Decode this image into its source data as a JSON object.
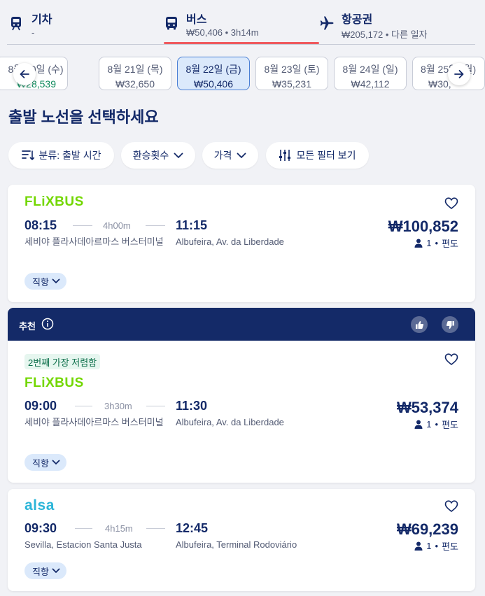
{
  "modes": {
    "train": {
      "title": "기차",
      "sub": "-"
    },
    "bus": {
      "title": "버스",
      "sub": "₩50,406 • 3h14m"
    },
    "flight": {
      "title": "항공권",
      "sub": "₩205,172 • 다른 일자"
    }
  },
  "dates": [
    {
      "date": "8월 20일 (수)",
      "price": "₩28,539"
    },
    {
      "date": "8월 21일 (목)",
      "price": "₩32,650"
    },
    {
      "date": "8월 22일 (금)",
      "price": "₩50,406"
    },
    {
      "date": "8월 23일 (토)",
      "price": "₩35,231"
    },
    {
      "date": "8월 24일 (일)",
      "price": "₩42,112"
    },
    {
      "date": "8월 25일 (월)",
      "price": "₩30,"
    }
  ],
  "page_title": "출발 노선을 선택하세요",
  "filters": {
    "sort": "분류: 출발 시간",
    "transfers": "환승횟수",
    "price": "가격",
    "all": "모든 필터 보기"
  },
  "recommend": {
    "label": "추천"
  },
  "results": [
    {
      "operator": "FLiXBUS",
      "depart": "08:15",
      "duration": "4h00m",
      "arrive": "11:15",
      "from": "세비야 플라사데아르마스 버스터미널",
      "to": "Albufeira, Av. da Liberdade",
      "price": "₩100,852",
      "pax": "1",
      "trip": "편도",
      "direct": "직항"
    },
    {
      "badge": "2번째 가장 저렴함",
      "operator": "FLiXBUS",
      "depart": "09:00",
      "duration": "3h30m",
      "arrive": "11:30",
      "from": "세비야 플라사데아르마스 버스터미널",
      "to": "Albufeira, Av. da Liberdade",
      "price": "₩53,374",
      "pax": "1",
      "trip": "편도",
      "direct": "직항"
    },
    {
      "operator": "alsa",
      "depart": "09:30",
      "duration": "4h15m",
      "arrive": "12:45",
      "from": "Sevilla, Estacion Santa Justa",
      "to": "Albufeira, Terminal Rodoviário",
      "price": "₩69,239",
      "pax": "1",
      "trip": "편도",
      "direct": "직항"
    }
  ],
  "colors": {
    "navy": "#132968",
    "accent_red": "#ef5a5f",
    "flixbus_green": "#73d700",
    "alsa_blue": "#2bb5d8",
    "selected_date_bg": "#dbe9fb",
    "recommend_band": "#142a68",
    "cheap_green": "#0d8a5c"
  },
  "icons": {
    "train": "train-icon",
    "bus": "bus-icon",
    "flight": "airplane-icon",
    "prev": "arrow-left-icon",
    "next": "arrow-right-icon",
    "sort": "sort-icon",
    "chevron": "chevron-down-icon",
    "filters": "sliders-icon",
    "favorite": "heart-icon",
    "person": "person-icon",
    "info": "info-icon",
    "thumbs_up": "thumbs-up-icon",
    "thumbs_down": "thumbs-down-icon"
  }
}
